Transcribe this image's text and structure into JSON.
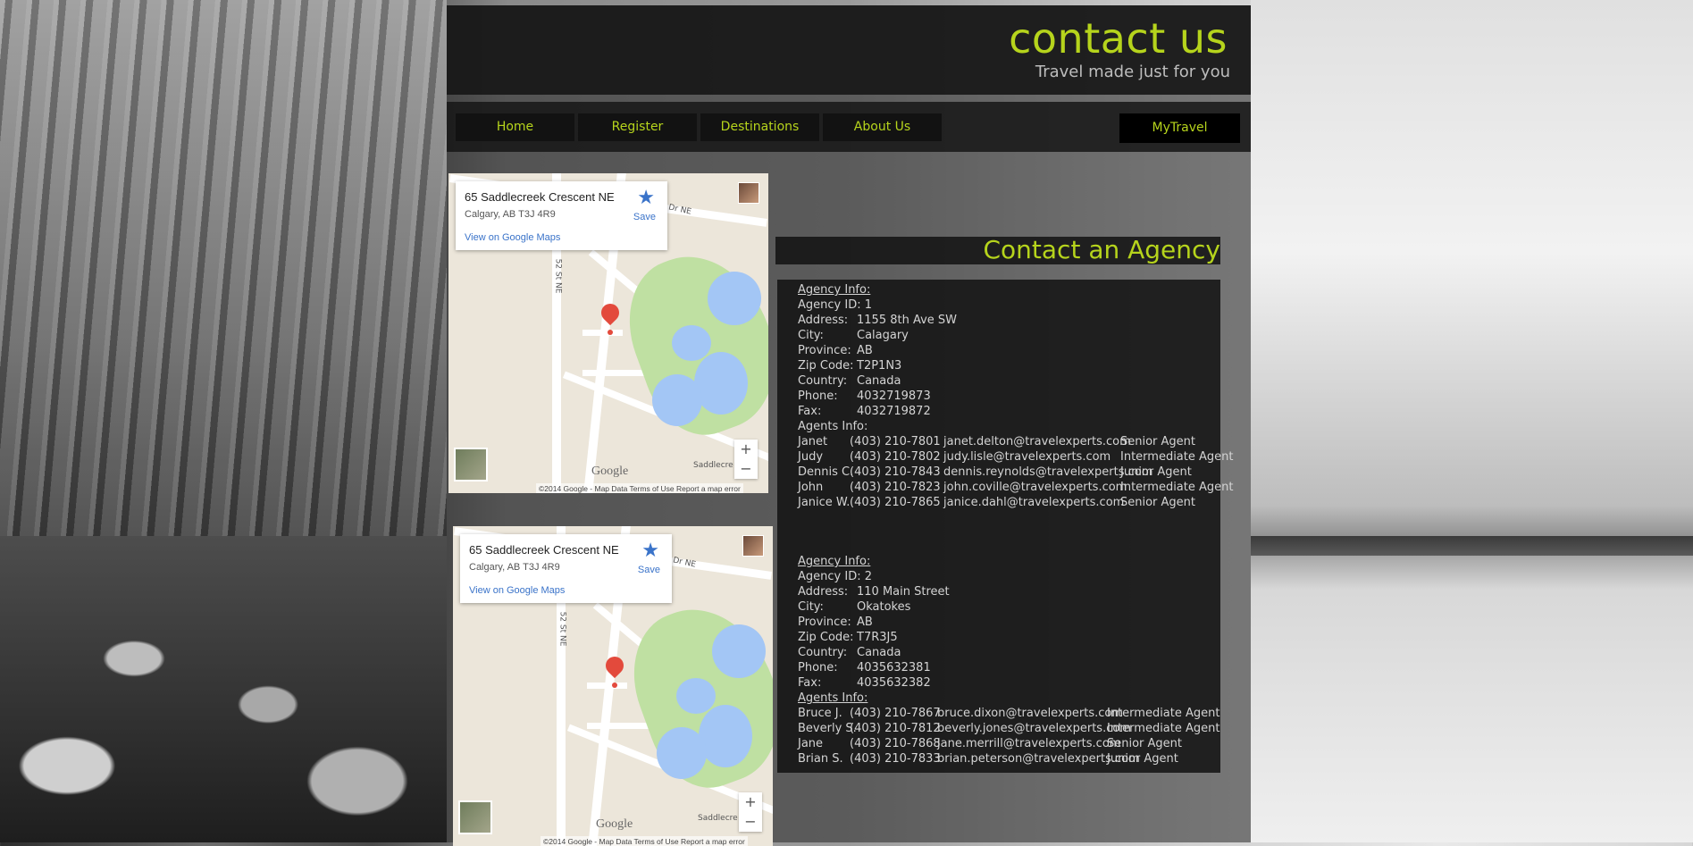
{
  "header": {
    "title": "contact us",
    "tagline": "Travel made just for you"
  },
  "nav": {
    "items": [
      "Home",
      "Register",
      "Destinations",
      "About Us"
    ],
    "mytravel": "MyTravel"
  },
  "maps": [
    {
      "address_line1": "65 Saddlecreek Crescent NE",
      "address_line2": "Calgary, AB T3J 4R9",
      "view_link": "View on Google Maps",
      "save": "Save",
      "street_ne": "Dr NE",
      "street_52": "52 St NE",
      "street_saddle": "Saddlecre",
      "google": "Google",
      "zoom_in": "+",
      "zoom_out": "−",
      "footer": "©2014 Google - Map Data    Terms of Use    Report a map error"
    },
    {
      "address_line1": "65 Saddlecreek Crescent NE",
      "address_line2": "Calgary, AB T3J 4R9",
      "view_link": "View on Google Maps",
      "save": "Save",
      "street_ne": "Dr NE",
      "street_52": "52 St NE",
      "street_saddle": "Saddlecre",
      "google": "Google",
      "zoom_in": "+",
      "zoom_out": "−",
      "footer": "©2014 Google - Map Data    Terms of Use    Report a map error"
    }
  ],
  "contact": {
    "heading": "Contact an Agency"
  },
  "agencies": [
    {
      "info_label": "Agency Info:",
      "id_line": "Agency ID: 1",
      "address_label": "Address:",
      "address": "1155 8th Ave SW",
      "city_label": "City:",
      "city": "Calagary",
      "province_label": "Province:",
      "province": "AB",
      "zip_label": "Zip Code:",
      "zip": "T2P1N3",
      "country_label": "Country:",
      "country": "Canada",
      "phone_label": "Phone:",
      "phone": "4032719873",
      "fax_label": "Fax:",
      "fax": "4032719872",
      "agents_label": "Agents Info:",
      "agents": [
        {
          "name": "Janet",
          "phone": "(403) 210-7801",
          "email": "janet.delton@travelexperts.com",
          "title": "Senior Agent"
        },
        {
          "name": "Judy",
          "phone": "(403) 210-7802",
          "email": "judy.lisle@travelexperts.com",
          "title": "Intermediate Agent"
        },
        {
          "name": "Dennis C.",
          "phone": "(403) 210-7843",
          "email": "dennis.reynolds@travelexperts.com",
          "title": "Junior Agent"
        },
        {
          "name": "John",
          "phone": "(403) 210-7823",
          "email": "john.coville@travelexperts.com",
          "title": "Intermediate Agent"
        },
        {
          "name": "Janice W.",
          "phone": "(403) 210-7865",
          "email": "janice.dahl@travelexperts.com",
          "title": "Senior Agent"
        }
      ]
    },
    {
      "info_label": "Agency Info:",
      "id_line": "Agency ID: 2",
      "address_label": "Address:",
      "address": "110 Main Street",
      "city_label": "City:",
      "city": "Okatokes",
      "province_label": "Province:",
      "province": "AB",
      "zip_label": "Zip Code:",
      "zip": "T7R3J5",
      "country_label": "Country:",
      "country": "Canada",
      "phone_label": "Phone:",
      "phone": "4035632381",
      "fax_label": "Fax:",
      "fax": "4035632382",
      "agents_label": "Agents Info:",
      "agents": [
        {
          "name": "Bruce    J.",
          "phone": "(403) 210-7867",
          "email": "bruce.dixon@travelexperts.com",
          "title": "Intermediate Agent"
        },
        {
          "name": "Beverly S.",
          "phone": "(403) 210-7812",
          "email": "beverly.jones@travelexperts.com",
          "title": "Intermediate Agent"
        },
        {
          "name": "Jane",
          "phone": "(403) 210-7868",
          "email": "jane.merrill@travelexperts.com",
          "title": "Senior Agent"
        },
        {
          "name": "Brian    S.",
          "phone": "(403) 210-7833",
          "email": "brian.peterson@travelexperts.com",
          "title": "Junior Agent"
        }
      ]
    }
  ]
}
